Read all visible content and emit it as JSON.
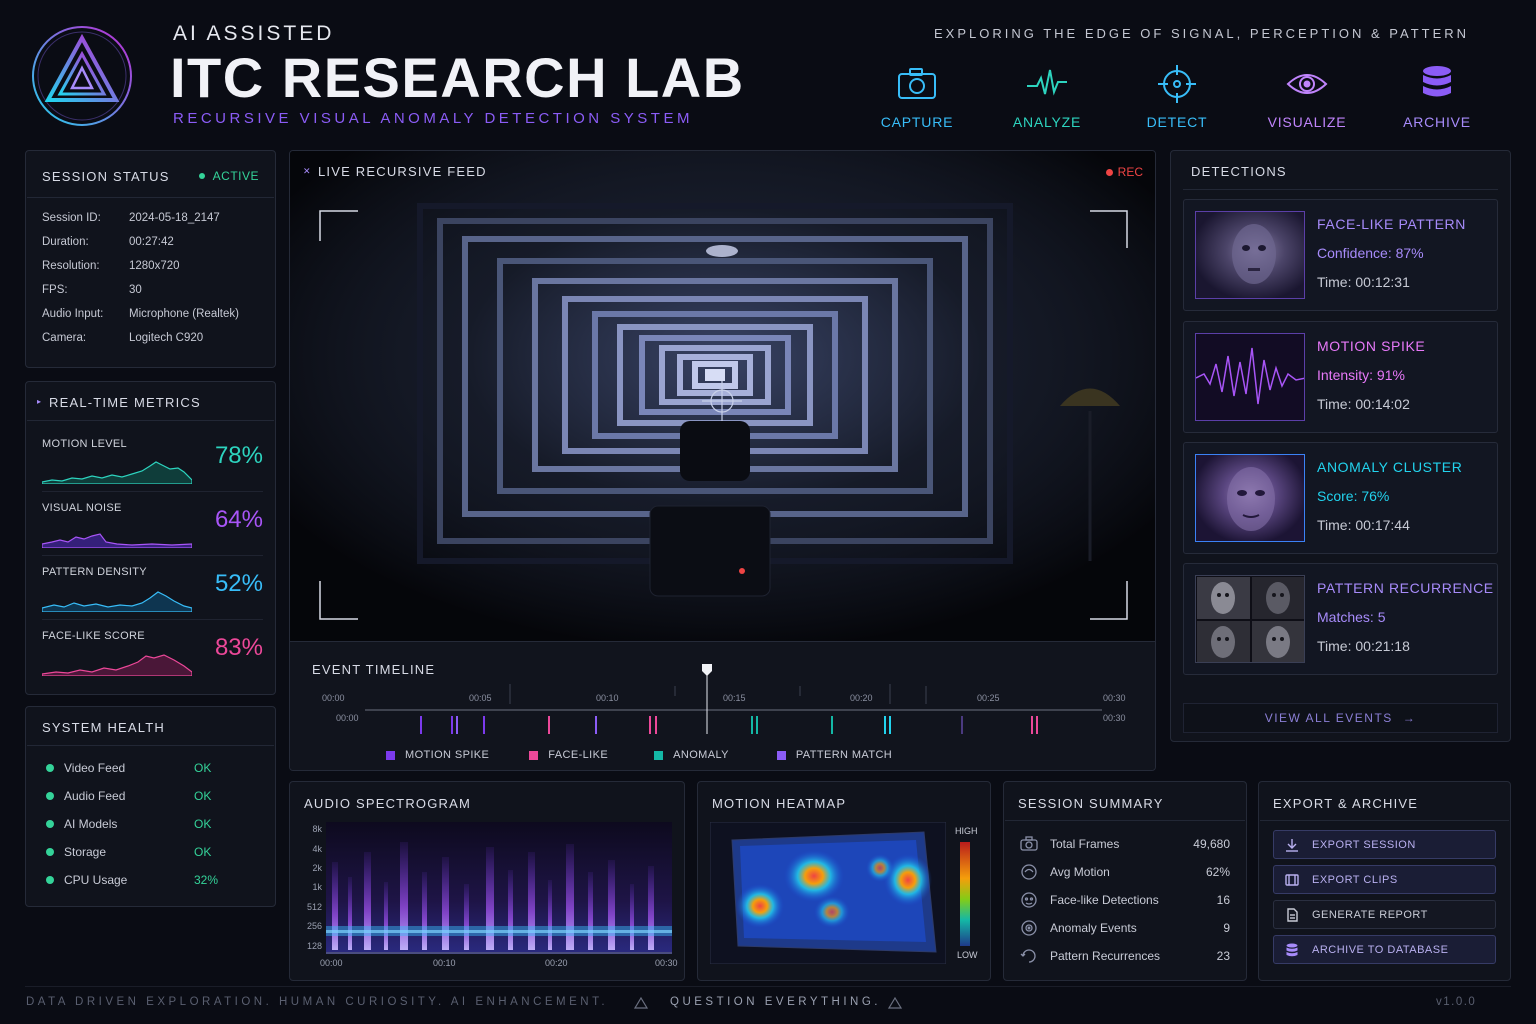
{
  "header": {
    "subtitle": "AI ASSISTED",
    "title": "ITC RESEARCH LAB",
    "tagline": "RECURSIVE VISUAL ANOMALY DETECTION SYSTEM",
    "motto": "EXPLORING THE EDGE OF SIGNAL, PERCEPTION & PATTERN",
    "nav": [
      {
        "label": "CAPTURE",
        "icon": "camera-icon",
        "color": "#38bdf8"
      },
      {
        "label": "ANALYZE",
        "icon": "pulse-icon",
        "color": "#2dd4bf"
      },
      {
        "label": "DETECT",
        "icon": "crosshair-icon",
        "color": "#38bdf8"
      },
      {
        "label": "VISUALIZE",
        "icon": "eye-icon",
        "color": "#c084fc"
      },
      {
        "label": "ARCHIVE",
        "icon": "database-icon",
        "color": "#a78bfa"
      }
    ]
  },
  "session": {
    "title": "SESSION STATUS",
    "status": "ACTIVE",
    "rows": [
      {
        "k": "Session ID:",
        "v": "2024-05-18_2147"
      },
      {
        "k": "Duration:",
        "v": "00:27:42"
      },
      {
        "k": "Resolution:",
        "v": "1280x720"
      },
      {
        "k": "FPS:",
        "v": "30"
      },
      {
        "k": "Audio Input:",
        "v": "Microphone (Realtek)"
      },
      {
        "k": "Camera:",
        "v": "Logitech C920"
      }
    ]
  },
  "metrics": {
    "title": "REAL-TIME METRICS",
    "items": [
      {
        "label": "MOTION LEVEL",
        "value": "78%",
        "color": "#2dd4bf"
      },
      {
        "label": "VISUAL NOISE",
        "value": "64%",
        "color": "#a855f7"
      },
      {
        "label": "PATTERN DENSITY",
        "value": "52%",
        "color": "#38bdf8"
      },
      {
        "label": "FACE-LIKE SCORE",
        "value": "83%",
        "color": "#ec4899"
      }
    ]
  },
  "health": {
    "title": "SYSTEM HEALTH",
    "items": [
      {
        "label": "Video Feed",
        "value": "OK"
      },
      {
        "label": "Audio Feed",
        "value": "OK"
      },
      {
        "label": "AI Models",
        "value": "OK"
      },
      {
        "label": "Storage",
        "value": "OK"
      },
      {
        "label": "CPU Usage",
        "value": "32%"
      }
    ]
  },
  "feed": {
    "title": "LIVE RECURSIVE FEED",
    "rec": "REC"
  },
  "timeline": {
    "title": "EVENT TIMELINE",
    "ticks": [
      "00:00",
      "00:05",
      "00:10",
      "00:15",
      "00:20",
      "00:25",
      "00:30"
    ],
    "start": "00:00",
    "end": "00:30",
    "legend": [
      {
        "label": "MOTION SPIKE",
        "color": "#7c3aed"
      },
      {
        "label": "FACE-LIKE",
        "color": "#ec4899"
      },
      {
        "label": "ANOMALY",
        "color": "#14b8a6"
      },
      {
        "label": "PATTERN MATCH",
        "color": "#8b5cf6"
      }
    ]
  },
  "detections": {
    "title": "DETECTIONS",
    "items": [
      {
        "title": "FACE-LIKE PATTERN",
        "detail": "Confidence: 87%",
        "time": "Time: 00:12:31",
        "color": "#a78bfa"
      },
      {
        "title": "MOTION SPIKE",
        "detail": "Intensity: 91%",
        "time": "Time: 00:14:02",
        "color": "#e879f9"
      },
      {
        "title": "ANOMALY CLUSTER",
        "detail": "Score: 76%",
        "time": "Time: 00:17:44",
        "color": "#22d3ee"
      },
      {
        "title": "PATTERN RECURRENCE",
        "detail": "Matches: 5",
        "time": "Time: 00:21:18",
        "color": "#a78bfa"
      }
    ],
    "view_all": "VIEW ALL EVENTS"
  },
  "spectrogram": {
    "title": "AUDIO SPECTROGRAM",
    "y_ticks": [
      "8k",
      "4k",
      "2k",
      "1k",
      "512",
      "256",
      "128"
    ],
    "x_ticks": [
      "00:00",
      "00:10",
      "00:20",
      "00:30"
    ]
  },
  "heatmap": {
    "title": "MOTION HEATMAP",
    "high": "HIGH",
    "low": "LOW"
  },
  "summary": {
    "title": "SESSION SUMMARY",
    "rows": [
      {
        "label": "Total Frames",
        "value": "49,680",
        "icon": "camera-icon"
      },
      {
        "label": "Avg Motion",
        "value": "62%",
        "icon": "motion-icon"
      },
      {
        "label": "Face-like Detections",
        "value": "16",
        "icon": "face-icon"
      },
      {
        "label": "Anomaly Events",
        "value": "9",
        "icon": "anomaly-icon"
      },
      {
        "label": "Pattern Recurrences",
        "value": "23",
        "icon": "recurrence-icon"
      }
    ]
  },
  "export": {
    "title": "EXPORT & ARCHIVE",
    "buttons": [
      {
        "label": "EXPORT SESSION",
        "icon": "download-icon"
      },
      {
        "label": "EXPORT CLIPS",
        "icon": "film-icon"
      },
      {
        "label": "GENERATE REPORT",
        "icon": "document-icon"
      },
      {
        "label": "ARCHIVE TO DATABASE",
        "icon": "database-icon"
      }
    ]
  },
  "footer": {
    "left": "DATA DRIVEN EXPLORATION. HUMAN CURIOSITY. AI ENHANCEMENT.",
    "mid": "QUESTION EVERYTHING.",
    "version": "v1.0.0"
  }
}
